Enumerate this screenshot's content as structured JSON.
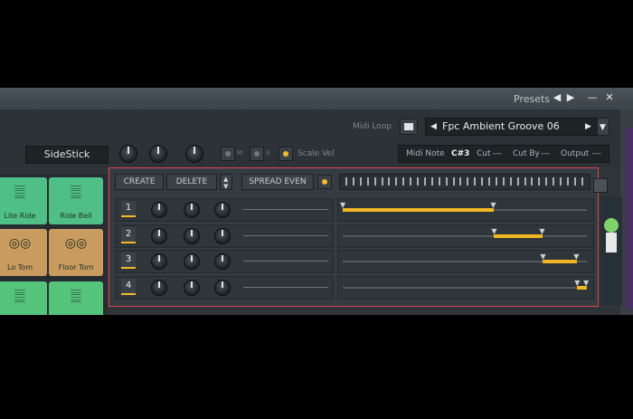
{
  "titlebar": {
    "presets_label": "Presets",
    "prev_arrow": "◀",
    "next_arrow": "▶",
    "minimize": "—",
    "close": "✕"
  },
  "pattern": {
    "midi_loop_label": "Midi Loop",
    "name": "Fpc Ambient Groove 06",
    "prev": "◀",
    "next": "▶",
    "menu": "▼"
  },
  "pad_controls": {
    "pad_name": "SideStick",
    "scale_vel_label": "Scale Vel",
    "m_label": "M",
    "s_label": "S"
  },
  "midi_note": {
    "label": "Midi Note",
    "value": "C#3",
    "cut_label": "Cut",
    "cut_value": "---",
    "cutby_label": "Cut By",
    "cutby_value": "---",
    "output_label": "Output",
    "output_value": "---"
  },
  "pads": [
    {
      "label": "Lite Ride",
      "icon": "cymbal-icon",
      "color": "#4fbf87"
    },
    {
      "label": "Ride Bell",
      "icon": "cymbal-icon",
      "color": "#4fbf87"
    },
    {
      "label": "Lo Tom",
      "icon": "drum-icon",
      "color": "#c99b5e"
    },
    {
      "label": "Floor Tom",
      "icon": "drum-icon",
      "color": "#c99b5e"
    }
  ],
  "layers": {
    "create_label": "CREATE",
    "delete_label": "DELETE",
    "spread_label": "SPREAD EVEN",
    "rows": [
      {
        "num": "1",
        "range": [
          0.0,
          0.62
        ]
      },
      {
        "num": "2",
        "range": [
          0.62,
          0.82
        ]
      },
      {
        "num": "3",
        "range": [
          0.82,
          0.96
        ]
      },
      {
        "num": "4",
        "range": [
          0.96,
          1.0
        ]
      }
    ]
  },
  "colors": {
    "accent": "#f2b523",
    "frame": "#e04450",
    "panel": "#2e3438"
  }
}
